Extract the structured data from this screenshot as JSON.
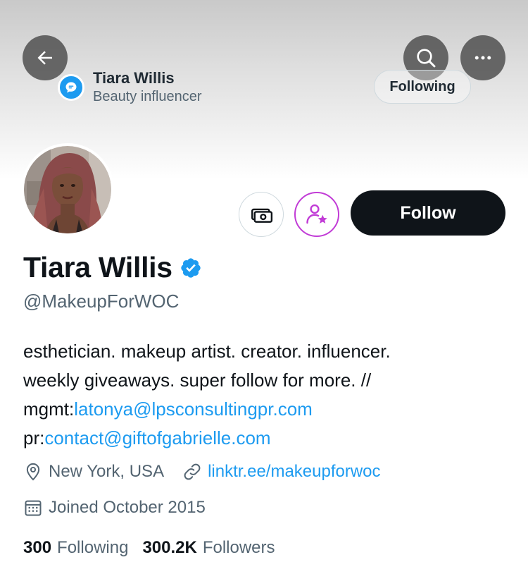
{
  "header": {
    "space_name": "Tiara Willis",
    "space_role": "Beauty influencer",
    "following_label": "Following",
    "back_icon": "arrow-left-icon",
    "search_icon": "search-icon",
    "more_icon": "more-icon"
  },
  "profile": {
    "display_name": "Tiara Willis",
    "handle": "@MakeupForWOC",
    "verified": true,
    "follow_label": "Follow",
    "tip_icon": "money-icon",
    "super_follow_icon": "super-follow-icon"
  },
  "bio": {
    "line1": "esthetician. makeup artist. creator. influencer.",
    "line2": "weekly giveaways. super follow for more. //",
    "mgmt_prefix": "mgmt:",
    "mgmt_email": "latonya@lpsconsultingpr.com",
    "pr_prefix": "pr:",
    "pr_email": "contact@giftofgabrielle.com"
  },
  "meta": {
    "location": "New York, USA",
    "website": "linktr.ee/makeupforwoc",
    "joined": "Joined October 2015"
  },
  "stats": {
    "following_count": "300",
    "following_label": "Following",
    "followers_count": "300.2K",
    "followers_label": "Followers"
  },
  "colors": {
    "accent": "#1d9bf0",
    "super_follow": "#c13bd6",
    "text_primary": "#0f1419",
    "text_secondary": "#536471"
  }
}
